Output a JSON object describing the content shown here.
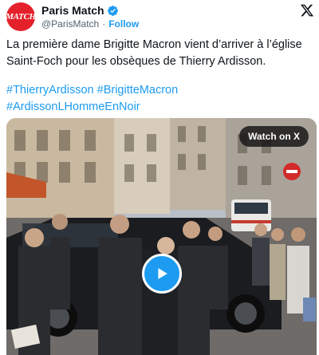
{
  "account": {
    "display_name": "Paris Match",
    "handle": "@ParisMatch",
    "separator": "·",
    "follow_label": "Follow",
    "avatar_text": "MATCH",
    "verified": true
  },
  "tweet": {
    "text": "La première dame Brigitte Macron vient d’arriver à l’église Saint-Foch pour les obsèques de Thierry Ardisson.",
    "hashtags": [
      "#ThierryArdisson",
      "#BrigitteMacron",
      "#ArdissonLHommeEnNoir"
    ]
  },
  "media": {
    "watch_label": "Watch on X",
    "play_icon": "play-icon"
  },
  "colors": {
    "brand_red": "#e4202b",
    "link_blue": "#1d9bf0",
    "muted_text": "#536471"
  }
}
